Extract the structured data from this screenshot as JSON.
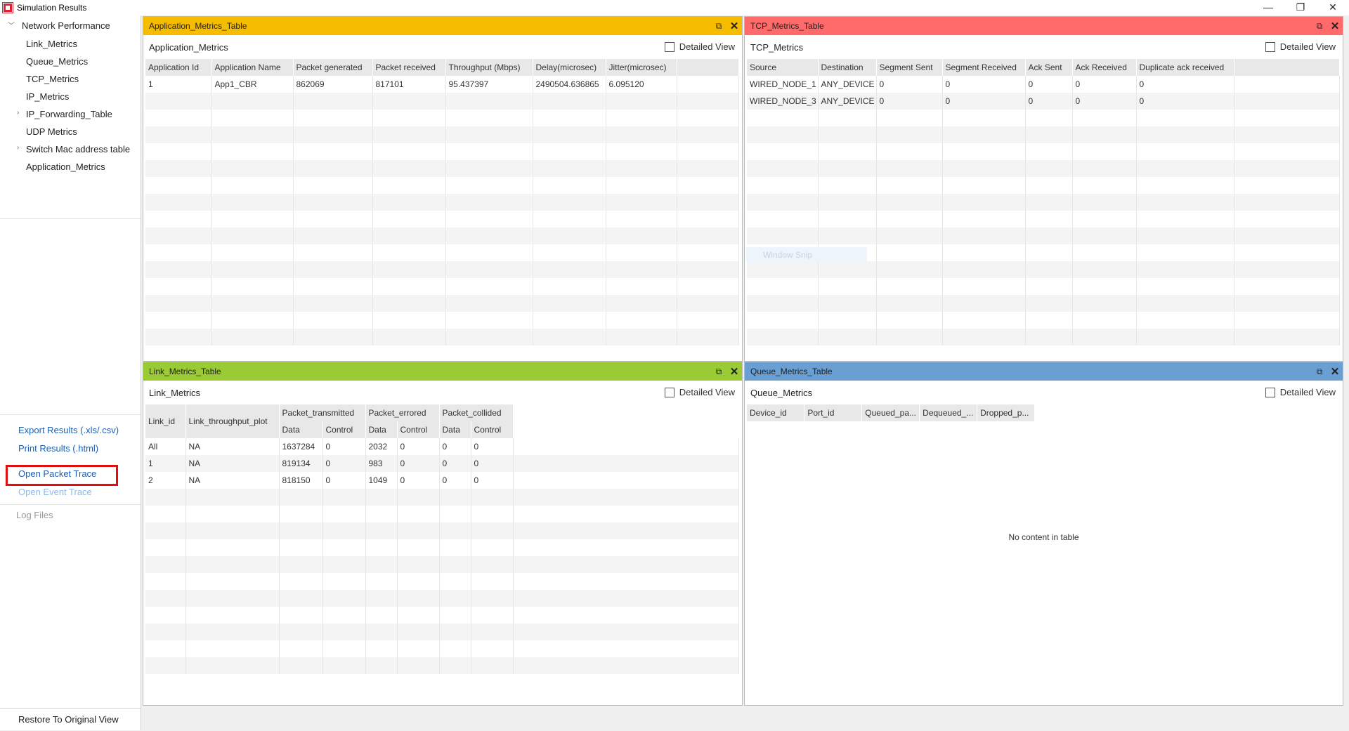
{
  "window": {
    "title": "Simulation Results",
    "controls": [
      "—",
      "❐",
      "✕"
    ]
  },
  "sidebar": {
    "root": "Network Performance",
    "items": [
      {
        "label": "Link_Metrics",
        "expandable": false
      },
      {
        "label": "Queue_Metrics",
        "expandable": false
      },
      {
        "label": "TCP_Metrics",
        "expandable": false
      },
      {
        "label": "IP_Metrics",
        "expandable": false
      },
      {
        "label": "IP_Forwarding_Table",
        "expandable": true
      },
      {
        "label": "UDP Metrics",
        "expandable": false
      },
      {
        "label": "Switch Mac address table",
        "expandable": true
      },
      {
        "label": "Application_Metrics",
        "expandable": false
      }
    ],
    "export_results": "Export Results (.xls/.csv)",
    "print_results": "Print Results (.html)",
    "open_packet_trace": "Open Packet Trace",
    "open_event_trace": "Open Event Trace",
    "log_files": "Log Files",
    "restore_view": "Restore To Original View"
  },
  "panels": {
    "application": {
      "header": "Application_Metrics_Table",
      "header_color": "#f5bc00",
      "name": "Application_Metrics",
      "detailed_view": "Detailed View",
      "columns": [
        "Application Id",
        "Application Name",
        "Packet generated",
        "Packet received",
        "Throughput (Mbps)",
        "Delay(microsec)",
        "Jitter(microsec)"
      ],
      "rows": [
        [
          "1",
          "App1_CBR",
          "862069",
          "817101",
          "95.437397",
          "2490504.636865",
          "6.095120"
        ]
      ]
    },
    "tcp": {
      "header": "TCP_Metrics_Table",
      "header_color": "#ff6b6b",
      "name": "TCP_Metrics",
      "detailed_view": "Detailed View",
      "columns": [
        "Source",
        "Destination",
        "Segment Sent",
        "Segment Received",
        "Ack Sent",
        "Ack Received",
        "Duplicate ack received"
      ],
      "rows": [
        [
          "WIRED_NODE_1",
          "ANY_DEVICE",
          "0",
          "0",
          "0",
          "0",
          "0"
        ],
        [
          "WIRED_NODE_3",
          "ANY_DEVICE",
          "0",
          "0",
          "0",
          "0",
          "0"
        ]
      ],
      "ghost_text": "Window Snip"
    },
    "link": {
      "header": "Link_Metrics_Table",
      "header_color": "#9bcb34",
      "name": "Link_Metrics",
      "detailed_view": "Detailed View",
      "col_id": "Link_id",
      "col_plot": "Link_throughput_plot",
      "group_transmitted": "Packet_transmitted",
      "group_errored": "Packet_errored",
      "group_collided": "Packet_collided",
      "sub_data": "Data",
      "sub_control": "Control",
      "rows": [
        [
          "All",
          "NA",
          "1637284",
          "0",
          "2032",
          "0",
          "0",
          "0"
        ],
        [
          "1",
          "NA",
          "819134",
          "0",
          "983",
          "0",
          "0",
          "0"
        ],
        [
          "2",
          "NA",
          "818150",
          "0",
          "1049",
          "0",
          "0",
          "0"
        ]
      ]
    },
    "queue": {
      "header": "Queue_Metrics_Table",
      "header_color": "#6a9fd4",
      "name": "Queue_Metrics",
      "detailed_view": "Detailed View",
      "columns": [
        "Device_id",
        "Port_id",
        "Queued_pa...",
        "Dequeued_...",
        "Dropped_p..."
      ],
      "empty_message": "No content in table"
    }
  }
}
